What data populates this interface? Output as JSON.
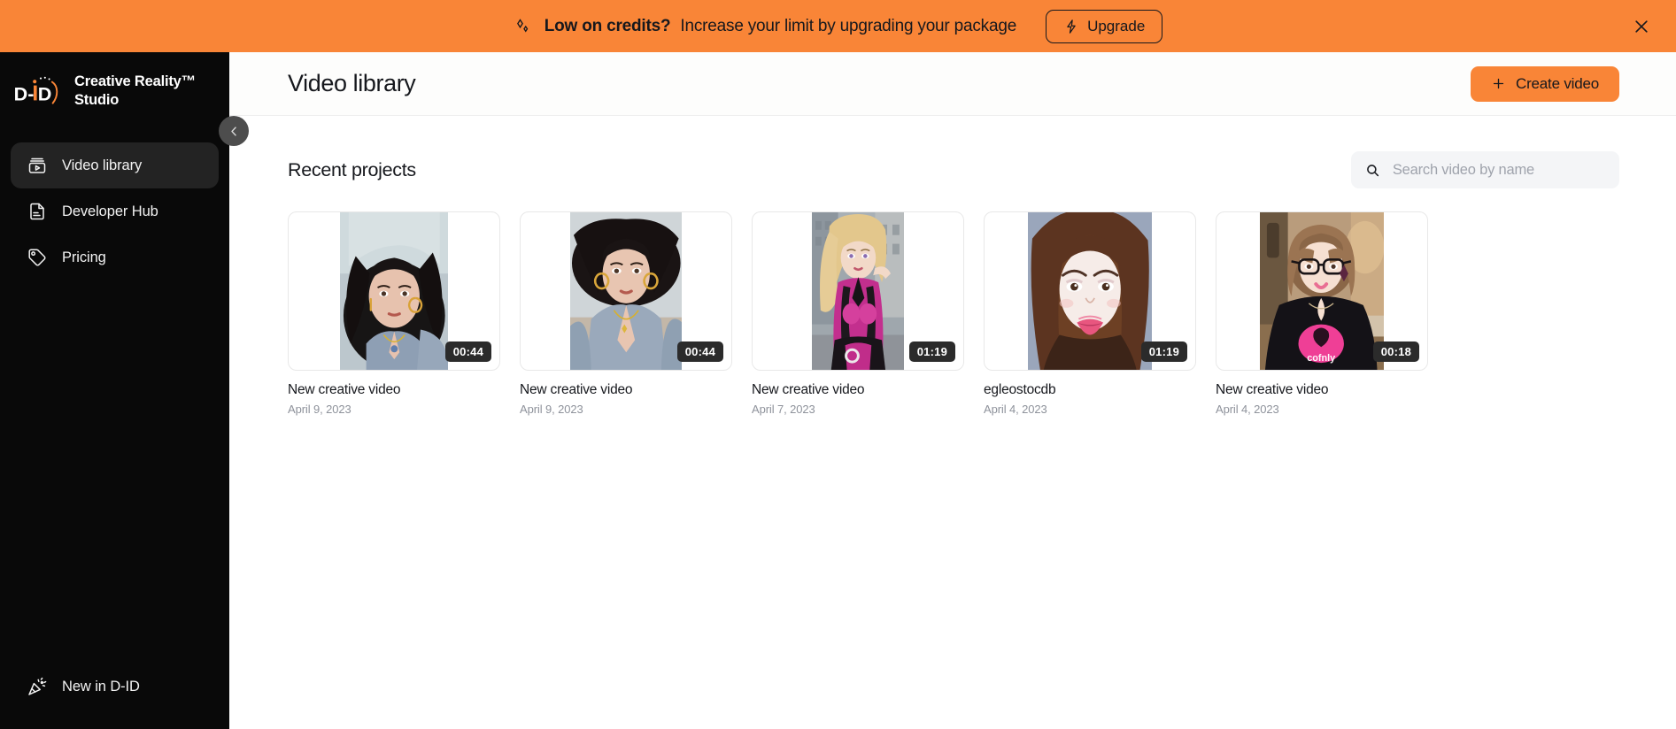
{
  "banner": {
    "icon": "sparkle-icon",
    "headline": "Low on credits?",
    "message": "Increase your limit by upgrading your package",
    "upgrade_label": "Upgrade",
    "upgrade_icon": "lightning-bolt-icon",
    "close_icon": "close-icon",
    "background_color": "#F98537",
    "text_color": "#16181d"
  },
  "sidebar": {
    "logo": "d-id-logo",
    "brand_name": "Creative Reality™ Studio",
    "collapse_icon": "chevron-left-icon",
    "items": [
      {
        "label": "Video library",
        "icon": "video-library-icon",
        "active": true
      },
      {
        "label": "Developer Hub",
        "icon": "document-icon",
        "active": false
      },
      {
        "label": "Pricing",
        "icon": "price-tag-icon",
        "active": false
      }
    ],
    "footer": {
      "label": "New in D-ID",
      "icon": "confetti-icon"
    },
    "background_color": "#090909",
    "active_item_color": "#232323"
  },
  "header": {
    "title": "Video library",
    "create_button": {
      "label": "Create video",
      "icon": "plus-icon",
      "color": "#F98537"
    }
  },
  "main": {
    "section_title": "Recent projects",
    "search": {
      "placeholder": "Search video by name",
      "value": "",
      "icon": "search-icon"
    },
    "projects": [
      {
        "title": "New creative video",
        "date": "April 9, 2023",
        "duration": "00:44",
        "thumb": "woman-dark-hair-denim-portrait",
        "aspect": "portrait-narrow"
      },
      {
        "title": "New creative video",
        "date": "April 9, 2023",
        "duration": "00:44",
        "thumb": "woman-windblown-hair-blue-shirt",
        "aspect": "portrait-narrow"
      },
      {
        "title": "New creative video",
        "date": "April 7, 2023",
        "duration": "01:19",
        "thumb": "blonde-ponytail-pink-suit-city",
        "aspect": "portrait-narrow"
      },
      {
        "title": "egleostocdb",
        "date": "April 4, 2023",
        "duration": "01:19",
        "thumb": "woman-brown-hair-blue-background",
        "aspect": "portrait-wide"
      },
      {
        "title": "New creative video",
        "date": "April 4, 2023",
        "duration": "00:18",
        "thumb": "woman-glasses-black-tshirt",
        "aspect": "portrait-wide"
      }
    ]
  }
}
